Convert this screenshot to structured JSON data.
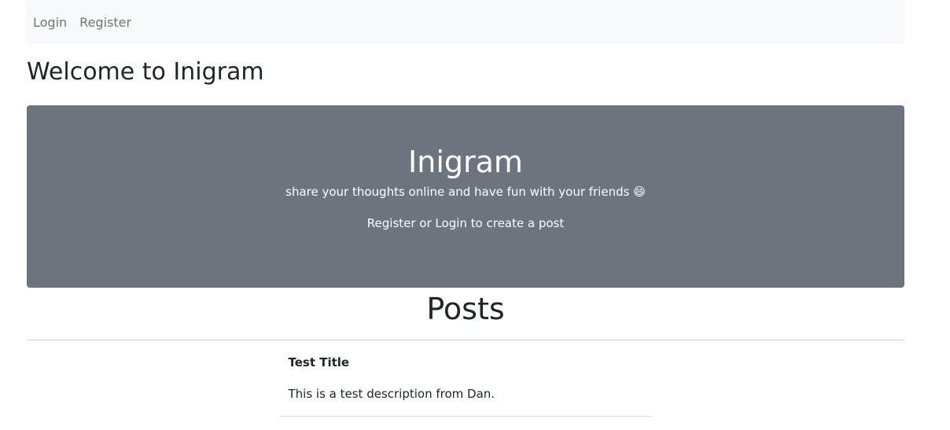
{
  "nav": {
    "items": [
      "Login",
      "Register"
    ]
  },
  "page": {
    "title": "Welcome to Inigram"
  },
  "hero": {
    "title": "Inigram",
    "tagline": "share your thoughts online and have fun with your friends 😄",
    "cta": "Register or Login to create a post"
  },
  "posts": {
    "heading": "Posts",
    "items": [
      {
        "title": "Test Title",
        "description": "This is a test description from Dan."
      }
    ]
  },
  "colors": {
    "navbar_bg": "#f8f9fa",
    "hero_bg": "#6c757d",
    "text": "#212529",
    "nav_link": "#6c757d"
  }
}
